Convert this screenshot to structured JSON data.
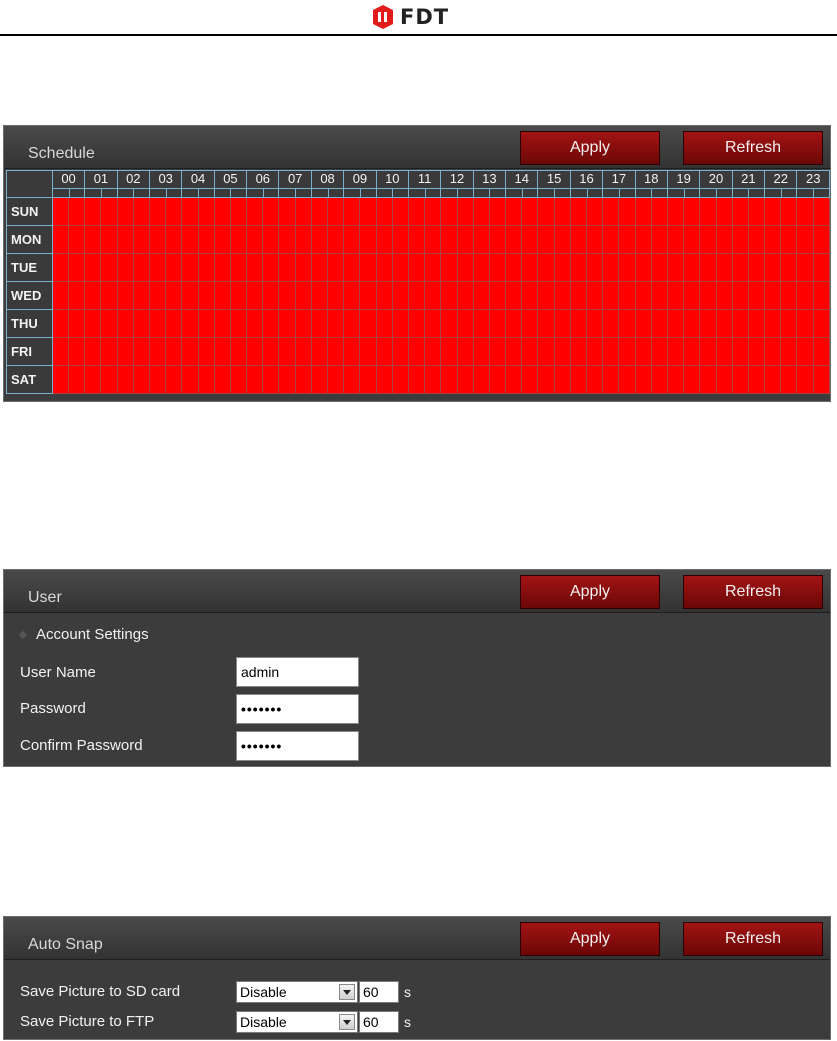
{
  "header": {
    "logo_text": "FDT"
  },
  "schedule": {
    "title": "Schedule",
    "apply_label": "Apply",
    "refresh_label": "Refresh",
    "hours": [
      "00",
      "01",
      "02",
      "03",
      "04",
      "05",
      "06",
      "07",
      "08",
      "09",
      "10",
      "11",
      "12",
      "13",
      "14",
      "15",
      "16",
      "17",
      "18",
      "19",
      "20",
      "21",
      "22",
      "23"
    ],
    "days": [
      "SUN",
      "MON",
      "TUE",
      "WED",
      "THU",
      "FRI",
      "SAT"
    ],
    "active_color": "#ff0000",
    "all_slots_active": true
  },
  "user": {
    "title": "User",
    "apply_label": "Apply",
    "refresh_label": "Refresh",
    "section_label": "Account Settings",
    "username_label": "User Name",
    "username_value": "admin",
    "password_label": "Password",
    "password_value": "•••••••",
    "confirm_label": "Confirm Password",
    "confirm_value": "•••••••"
  },
  "autosnap": {
    "title": "Auto Snap",
    "apply_label": "Apply",
    "refresh_label": "Refresh",
    "rows": [
      {
        "label": "Save Picture to SD card",
        "select": "Disable",
        "interval": "60",
        "unit": "s"
      },
      {
        "label": "Save Picture to FTP",
        "select": "Disable",
        "interval": "60",
        "unit": "s"
      }
    ]
  }
}
